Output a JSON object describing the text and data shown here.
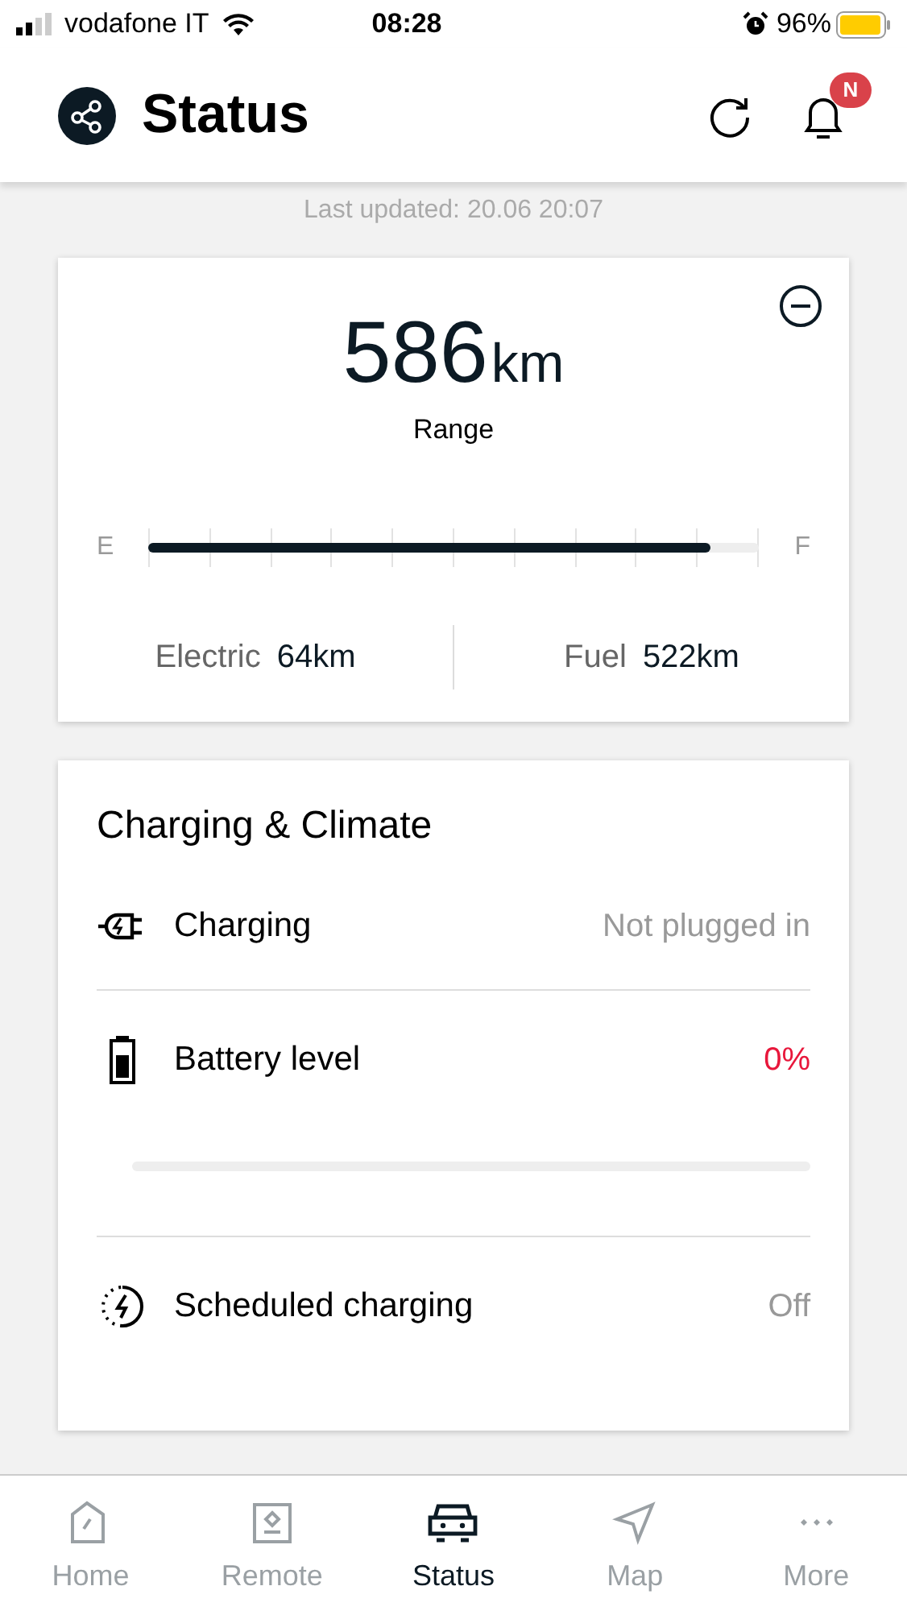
{
  "status_bar": {
    "carrier": "vodafone IT",
    "time": "08:28",
    "battery": "96%"
  },
  "header": {
    "title": "Status",
    "badge": "N"
  },
  "last_updated": "Last updated: 20.06 20:07",
  "range": {
    "value": "586",
    "unit": "km",
    "label": "Range",
    "empty": "E",
    "full": "F",
    "level": 0.92,
    "split": [
      {
        "label": "Electric",
        "value": "64km"
      },
      {
        "label": "Fuel",
        "value": "522km"
      }
    ]
  },
  "charging": {
    "title": "Charging & Climate",
    "rows": [
      {
        "kind": "plug",
        "label": "Charging",
        "value": "Not plugged in",
        "alert": false
      },
      {
        "kind": "battery",
        "label": "Battery level",
        "value": "0%",
        "alert": true
      },
      {
        "kind": "schedule",
        "label": "Scheduled charging",
        "value": "Off",
        "alert": false
      }
    ]
  },
  "nav": [
    {
      "label": "Home",
      "selected": false
    },
    {
      "label": "Remote",
      "selected": false
    },
    {
      "label": "Status",
      "selected": true
    },
    {
      "label": "Map",
      "selected": false
    },
    {
      "label": "More",
      "selected": false
    }
  ]
}
